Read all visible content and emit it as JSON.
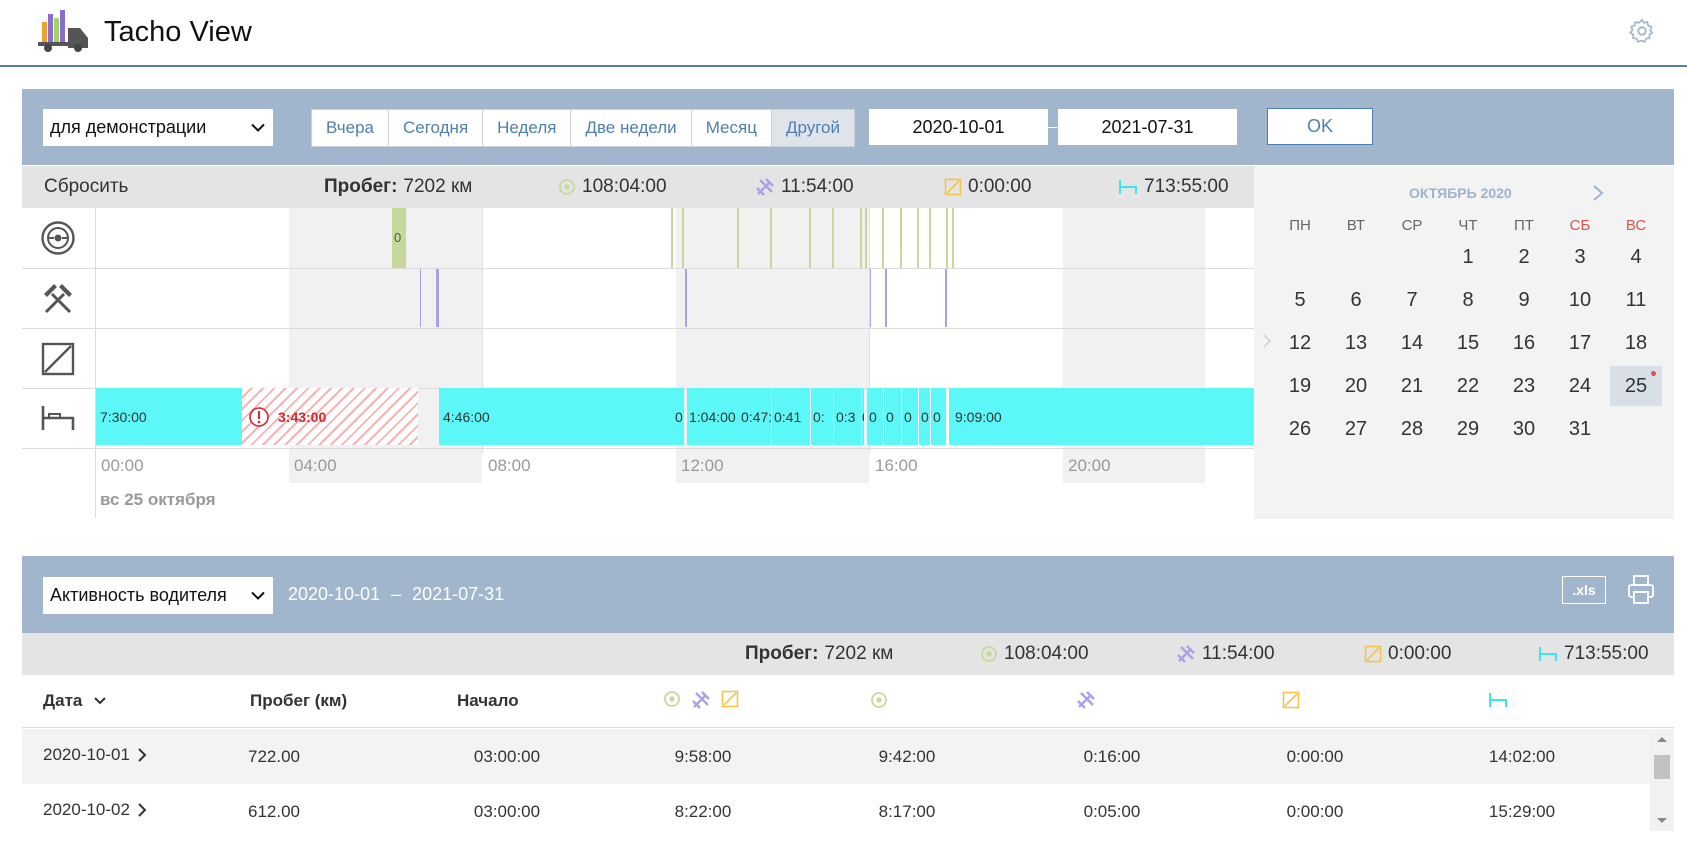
{
  "app": {
    "title": "Tacho View",
    "logo_icon": "truck-chart-logo",
    "settings_icon": "gear-icon"
  },
  "filter": {
    "vehicle_select": "для демонстрации",
    "periods": [
      "Вчера",
      "Сегодня",
      "Неделя",
      "Две недели",
      "Месяц",
      "Другой"
    ],
    "active_period": "Другой",
    "date_from": "2020-10-01",
    "date_to": "2021-07-31",
    "ok_label": "OK"
  },
  "summary": {
    "reset_label": "Сбросить",
    "mileage_label": "Пробег:",
    "mileage_value": "7202 км",
    "driving": "108:04:00",
    "work": "11:54:00",
    "availability": "0:00:00",
    "rest": "713:55:00"
  },
  "colors": {
    "driving": "#c6d99b",
    "work": "#a9a1e6",
    "availability": "#f2c64d",
    "rest": "#3de5ec",
    "header_bg": "#a1b6cd",
    "accent": "#4d7fb0",
    "alert": "#d9252b"
  },
  "timeline": {
    "row_icons": [
      "steering-wheel-icon",
      "hammers-icon",
      "availability-icon",
      "bed-icon"
    ],
    "driving_label": "0",
    "ticks": [
      "00:00",
      "04:00",
      "08:00",
      "12:00",
      "16:00",
      "20:00"
    ],
    "day_label": "вс 25 октября",
    "rest_segments": [
      "7:30:00",
      "3:43:00",
      "4:46:00",
      "0",
      "1:04:00",
      "0:47:",
      "0:41",
      "0:",
      "0:3",
      "0",
      "0",
      "0",
      "0",
      "0",
      "0",
      "9:09:00"
    ]
  },
  "calendar": {
    "month": "ОКТЯБРЬ 2020",
    "weekdays": [
      "ПН",
      "ВТ",
      "СР",
      "ЧТ",
      "ПТ",
      "СБ",
      "ВС"
    ],
    "days": [
      "1",
      "2",
      "3",
      "4",
      "5",
      "6",
      "7",
      "8",
      "9",
      "10",
      "11",
      "12",
      "13",
      "14",
      "15",
      "16",
      "17",
      "18",
      "19",
      "20",
      "21",
      "22",
      "23",
      "24",
      "25",
      "26",
      "27",
      "28",
      "29",
      "30",
      "31"
    ],
    "selected": "25"
  },
  "report": {
    "select": "Активность водителя",
    "range_from": "2020-10-01",
    "range_sep": "–",
    "range_to": "2021-07-31",
    "xls_label": ".xls",
    "print_icon": "printer-icon",
    "summary": {
      "mileage_label": "Пробег:",
      "mileage_value": "7202 км",
      "driving": "108:04:00",
      "work": "11:54:00",
      "availability": "0:00:00",
      "rest": "713:55:00"
    },
    "columns": {
      "date": "Дата",
      "mileage": "Пробег (км)",
      "start": "Начало"
    },
    "rows": [
      {
        "date": "2020-10-01",
        "mileage": "722.00",
        "start": "03:00:00",
        "total": "9:58:00",
        "driving": "9:42:00",
        "work": "0:16:00",
        "availability": "0:00:00",
        "rest": "14:02:00"
      },
      {
        "date": "2020-10-02",
        "mileage": "612.00",
        "start": "03:00:00",
        "total": "8:22:00",
        "driving": "8:17:00",
        "work": "0:05:00",
        "availability": "0:00:00",
        "rest": "15:29:00"
      }
    ]
  }
}
